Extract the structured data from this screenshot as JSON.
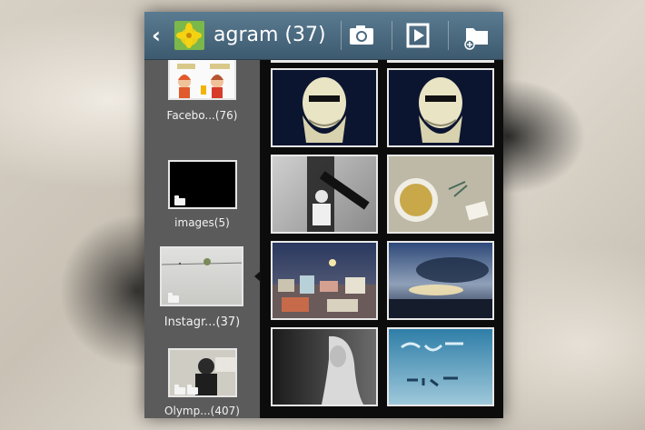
{
  "action_bar": {
    "title": "agram (37)",
    "back_icon": "chevron-left-icon",
    "camera_icon": "camera-icon",
    "slideshow_icon": "play-icon",
    "new_album_icon": "folder-add-icon"
  },
  "albums": [
    {
      "label": "Facebo...(76)"
    },
    {
      "label": "images(5)"
    },
    {
      "label": "Instagr...(37)"
    },
    {
      "label": "Olymp...(407)"
    }
  ],
  "colors": {
    "action_bar": "#4a6a80",
    "panel": "#5b5b5b",
    "grid_bg": "#0c0c0c",
    "thumb_border": "#e6e6e6"
  }
}
